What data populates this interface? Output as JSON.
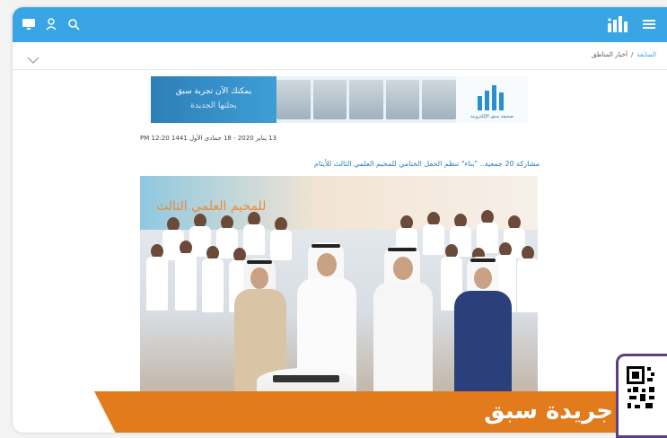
{
  "header": {
    "left_icons": [
      "monitor-icon",
      "user-icon",
      "search-icon"
    ],
    "right_icons": [
      "sabq-logo",
      "menu-icon"
    ],
    "bar_color": "#3aa5e4"
  },
  "breadcrumb": {
    "home": "السابقة",
    "separator": "/",
    "current": "أخبار المناطق"
  },
  "banner": {
    "line1": "يمكنك الآن تجربة سبق",
    "line2": "بحلتها الجديدة",
    "logo_caption": "صحيفة سبق الإلكترونية"
  },
  "article": {
    "meta": "13 يناير 2020 - 18 جمادى الأول 1441 12:20 PM",
    "headline": "مشاركة 20 جمعية.. \"بناء\" تنظم الحفل الختامي للمخيم العلمي الثالث للأيتام",
    "photo_wall_text": "للمخيم العلمي الثالث"
  },
  "overlay": {
    "brand": "جريدة سبق",
    "accent": "#e27b1c",
    "qr_border": "#5a3e86"
  }
}
